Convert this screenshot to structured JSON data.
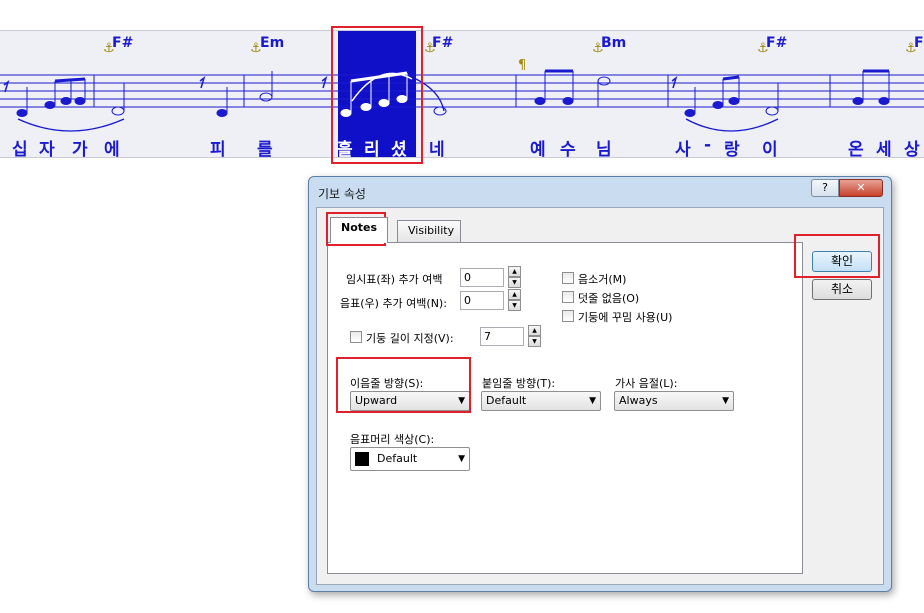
{
  "score": {
    "chords": [
      "F#",
      "Em",
      "F#",
      "Bm",
      "F#",
      "F#"
    ],
    "lyrics": [
      "십",
      "자",
      "가",
      "에",
      "피",
      "를",
      "흘",
      "리",
      "셨",
      "네",
      "예",
      "수",
      "님",
      "사",
      "-",
      "랑",
      "이",
      "온",
      "세",
      "상"
    ],
    "colors": {
      "notes": "#1a1ad0",
      "selection": "#1010c8",
      "highlight_box": "#e0202a"
    }
  },
  "dialog": {
    "title": "기보 속성",
    "help_label": "?",
    "close_label": "✕",
    "tabs": [
      {
        "label": "Notes",
        "active": true
      },
      {
        "label": "Visibility",
        "active": false
      }
    ],
    "accidental_spacing": {
      "label": "임시표(좌) 추가 여백",
      "value": "0"
    },
    "note_spacing": {
      "label": "음표(우) 추가 여백(N):",
      "value": "0"
    },
    "stem_length": {
      "label": "기둥 길이 지정(V):",
      "value": "7",
      "checked": false
    },
    "checkboxes": [
      {
        "label": "음소거(M)",
        "checked": false
      },
      {
        "label": "덧줄 없음(O)",
        "checked": false
      },
      {
        "label": "기둥에 꾸밈 사용(U)",
        "checked": false
      }
    ],
    "slur_direction": {
      "label": "이음줄 방향(S):",
      "value": "Upward"
    },
    "tie_direction": {
      "label": "붙임줄 방향(T):",
      "value": "Default"
    },
    "lyric_syllable": {
      "label": "가사 음절(L):",
      "value": "Always"
    },
    "notehead_color": {
      "label": "음표머리 색상(C):",
      "value": "Default",
      "swatch": "#000000"
    },
    "ok_label": "확인",
    "cancel_label": "취소"
  }
}
